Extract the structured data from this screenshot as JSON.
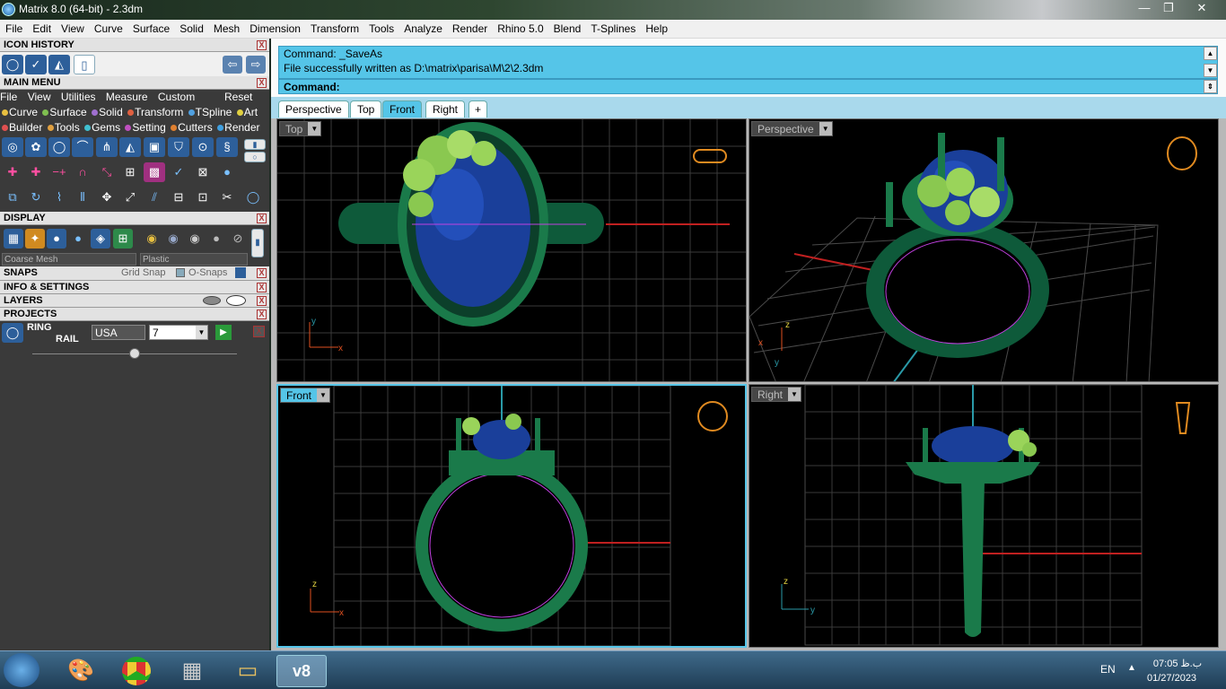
{
  "window": {
    "title": "Matrix 8.0 (64-bit) - 2.3dm",
    "min": "—",
    "max": "❐",
    "close": "✕"
  },
  "menubar": [
    "File",
    "Edit",
    "View",
    "Curve",
    "Surface",
    "Solid",
    "Mesh",
    "Dimension",
    "Transform",
    "Tools",
    "Analyze",
    "Render",
    "Rhino 5.0",
    "Blend",
    "T-Splines",
    "Help"
  ],
  "panel": {
    "icon_history": "ICON HISTORY",
    "main_menu": "MAIN MENU",
    "main_menu_items": [
      "File",
      "View",
      "Utilities",
      "Measure",
      "Custom"
    ],
    "reset": "Reset",
    "categories1": [
      "Curve",
      "Surface",
      "Solid",
      "Transform",
      "TSpline",
      "Art"
    ],
    "categories2": [
      "Builder",
      "Tools",
      "Gems",
      "Setting",
      "Cutters",
      "Render"
    ],
    "display": "DISPLAY",
    "mesh_select": "Coarse Mesh",
    "material_select": "Plastic",
    "snaps": "SNAPS",
    "grid_snap": "Grid Snap",
    "osnaps": "O-Snaps",
    "info": "INFO & SETTINGS",
    "layers": "LAYERS",
    "projects": "PROJECTS",
    "ring_label": "RING",
    "rail_label": "RAIL",
    "size_system": "USA",
    "size_value": "7",
    "close_x": "X"
  },
  "command": {
    "line1": "Command: _SaveAs",
    "line2": "File successfully written as D:\\matrix\\parisa\\M\\2\\2.3dm",
    "prompt": "Command:"
  },
  "tabs": [
    "Perspective",
    "Top",
    "Front",
    "Right",
    "+"
  ],
  "active_tab": "Front",
  "viewports": {
    "top": {
      "label": "Top"
    },
    "perspective": {
      "label": "Perspective"
    },
    "front": {
      "label": "Front"
    },
    "right": {
      "label": "Right"
    }
  },
  "axes": {
    "x": "x",
    "y": "y",
    "z": "z"
  },
  "taskbar": {
    "lang": "EN",
    "time": "07:05 ب.ظ",
    "date": "01/27/2023"
  },
  "colors": {
    "accent": "#55c5e8",
    "ring_green": "#1f8a5a",
    "stone_blue": "#1a3f9a",
    "flower_green": "#9ad45a",
    "ring_preview": "#e08a20"
  }
}
